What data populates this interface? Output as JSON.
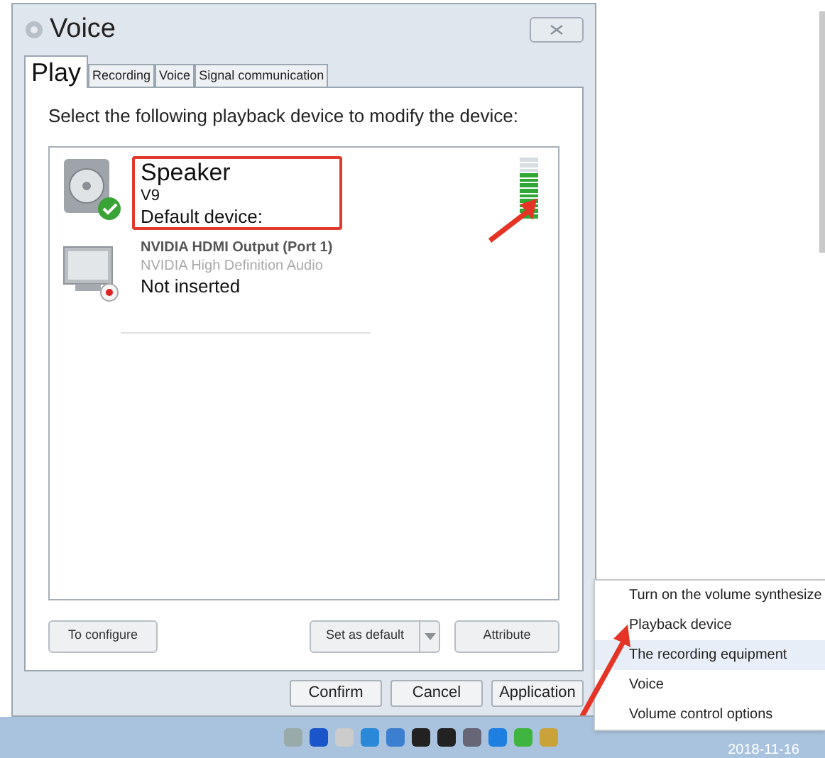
{
  "window": {
    "title": "Voice"
  },
  "tabs": [
    {
      "label": "Play",
      "selected": true
    },
    {
      "label": "Recording",
      "selected": false
    },
    {
      "label": "Voice",
      "selected": false
    },
    {
      "label": "Signal communication",
      "selected": false
    }
  ],
  "instruction": "Select the following playback device to modify the device:",
  "devices": [
    {
      "kind": "speaker",
      "name": "Speaker",
      "detail": "V9",
      "status": "Default device:",
      "is_default": true,
      "level": 0.75
    },
    {
      "kind": "monitor",
      "name": "NVIDIA HDMI Output (Port 1)",
      "detail": "NVIDIA High Definition Audio",
      "status": "Not inserted",
      "is_default": false
    }
  ],
  "panel_buttons": {
    "configure": "To configure",
    "set_default": "Set as default",
    "attribute": "Attribute"
  },
  "dialog_buttons": [
    "Confirm",
    "Cancel",
    "Application"
  ],
  "context_menu": [
    {
      "label": "Turn on the volume synthesize",
      "selected": false
    },
    {
      "label": "Playback device",
      "selected": false
    },
    {
      "label": "The recording equipment",
      "selected": true
    },
    {
      "label": "Voice",
      "selected": false
    },
    {
      "label": "Volume control options",
      "selected": false
    }
  ],
  "taskbar": {
    "date": "2018-11-16"
  }
}
